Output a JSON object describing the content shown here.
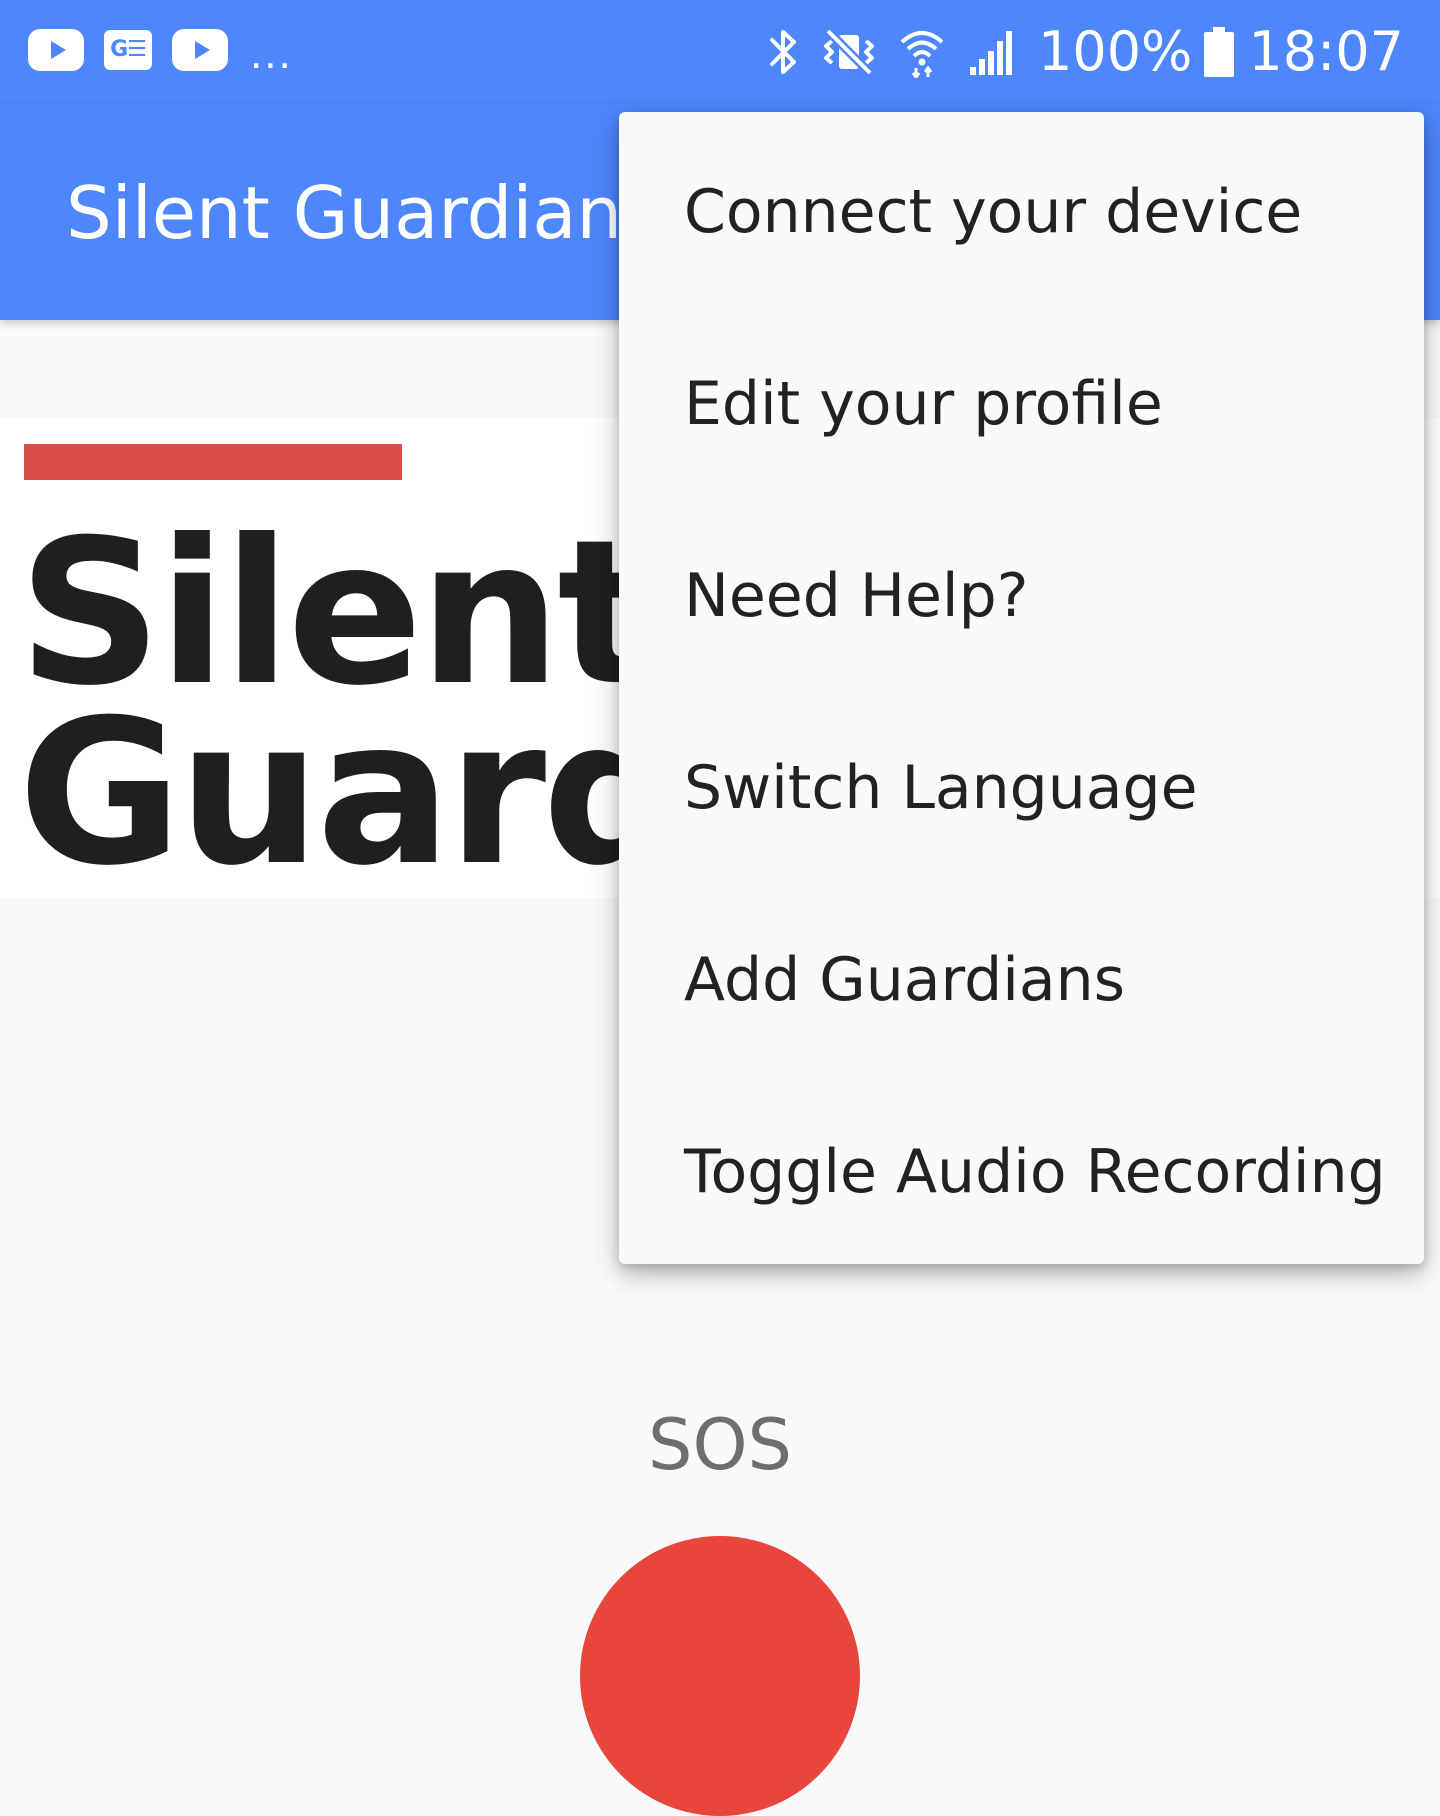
{
  "status_bar": {
    "notification_icons": [
      "youtube-icon",
      "ge-icon",
      "youtube-icon"
    ],
    "more_indicator": "...",
    "system_icons": [
      "bluetooth-icon",
      "vibrate-icon",
      "wifi-icon",
      "signal-icon"
    ],
    "battery_percent": "100%",
    "time": "18:07",
    "background_color": "#4e86fc"
  },
  "app_bar": {
    "title": "Silent Guardian",
    "background_color": "#4e86fc"
  },
  "logo": {
    "line1": "Silent",
    "line2": "Guard",
    "accent_color": "#d94e48"
  },
  "overflow_menu": {
    "items": [
      {
        "label": "Connect your device"
      },
      {
        "label": "Edit your profile"
      },
      {
        "label": "Need Help?"
      },
      {
        "label": "Switch Language"
      },
      {
        "label": "Add Guardians"
      },
      {
        "label": "Toggle Audio Recording"
      }
    ]
  },
  "sos": {
    "label": "SOS",
    "button_color": "#e8453c"
  }
}
